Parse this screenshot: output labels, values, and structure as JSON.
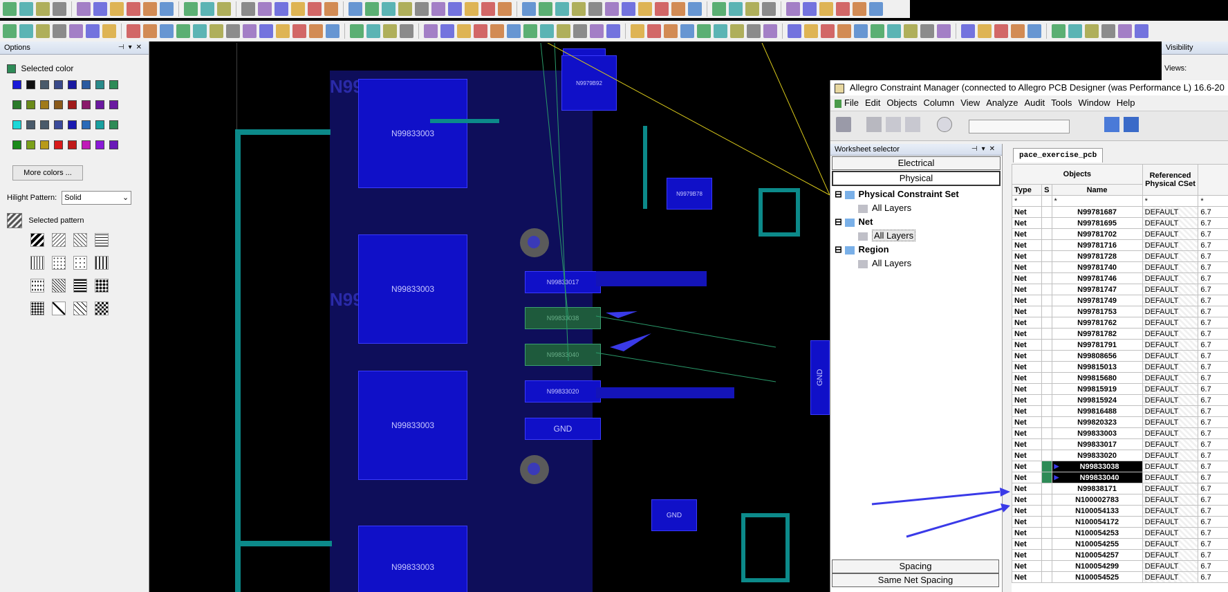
{
  "options": {
    "title": "Options",
    "selected_color_label": "Selected color",
    "more_colors_label": "More colors ...",
    "hilight_label": "Hilight Pattern:",
    "hilight_value": "Solid",
    "selected_pattern_label": "Selected pattern",
    "selected_color": "#2e8b57",
    "swatch_rows": [
      [
        "#1a1ad8",
        "#111111",
        "#4a5a6a",
        "#3a4a8a",
        "#1a1aa0",
        "#2a5aa0",
        "#2a8a8a",
        "#2e8b57"
      ],
      [
        "#2a7a2a",
        "#6a8a1a",
        "#a07a1a",
        "#8a5a1a",
        "#a01a1a",
        "#8a1a6a",
        "#6a1aa0",
        "#6a1aa0"
      ],
      [
        "#1ad8d8",
        "#4a5a6a",
        "#4a5a6a",
        "#3a4a9a",
        "#1a1ab0",
        "#2a6ab8",
        "#1aa0a0",
        "#2e8b57"
      ],
      [
        "#1a8a1a",
        "#7aa01a",
        "#b89a1a",
        "#d81a1a",
        "#c01a1a",
        "#c01ab8",
        "#8a1ad8",
        "#6a1ab8"
      ]
    ]
  },
  "canvas": {
    "pads_large": [
      "N99833003",
      "N99833003",
      "N99833003",
      "N99833003"
    ],
    "ghost_label_1": "N99833003",
    "ghost_label_2": "N99833003",
    "pad_n1": "N99833017",
    "pad_n2": "N99833038",
    "pad_n3": "N99833040",
    "pad_n4": "N99833020",
    "pad_gnd": "GND",
    "pad_gnd2": "GND",
    "pad_gnd3": "GND",
    "small_label_1": "N9979B92",
    "small_label_2": "N9979B78"
  },
  "visibility": {
    "title": "Visibility",
    "views_label": "Views:"
  },
  "cm": {
    "title": "Allegro Constraint Manager (connected to Allegro PCB Designer (was Performance L) 16.6-20",
    "menu": [
      "File",
      "Edit",
      "Objects",
      "Column",
      "View",
      "Analyze",
      "Audit",
      "Tools",
      "Window",
      "Help"
    ],
    "ws_title": "Worksheet selector",
    "btn_electrical": "Electrical",
    "btn_physical": "Physical",
    "tree": {
      "pcs": "Physical Constraint Set",
      "pcs_layers": "All Layers",
      "net": "Net",
      "net_layers": "All Layers",
      "region": "Region",
      "region_layers": "All Layers"
    },
    "btn_spacing": "Spacing",
    "btn_same_net": "Same Net Spacing",
    "tab": "pace_exercise_pcb",
    "grid": {
      "head_objects": "Objects",
      "head_ref": "Referenced Physical CSet",
      "col_type": "Type",
      "col_s": "S",
      "col_name": "Name",
      "filter_type": "*",
      "filter_name": "*",
      "filter_ref": "*",
      "filter_lw": "*",
      "rows": [
        {
          "type": "Net",
          "name": "N99781687",
          "ref": "DEFAULT",
          "lw": "6.7"
        },
        {
          "type": "Net",
          "name": "N99781695",
          "ref": "DEFAULT",
          "lw": "6.7"
        },
        {
          "type": "Net",
          "name": "N99781702",
          "ref": "DEFAULT",
          "lw": "6.7"
        },
        {
          "type": "Net",
          "name": "N99781716",
          "ref": "DEFAULT",
          "lw": "6.7"
        },
        {
          "type": "Net",
          "name": "N99781728",
          "ref": "DEFAULT",
          "lw": "6.7"
        },
        {
          "type": "Net",
          "name": "N99781740",
          "ref": "DEFAULT",
          "lw": "6.7"
        },
        {
          "type": "Net",
          "name": "N99781746",
          "ref": "DEFAULT",
          "lw": "6.7"
        },
        {
          "type": "Net",
          "name": "N99781747",
          "ref": "DEFAULT",
          "lw": "6.7"
        },
        {
          "type": "Net",
          "name": "N99781749",
          "ref": "DEFAULT",
          "lw": "6.7"
        },
        {
          "type": "Net",
          "name": "N99781753",
          "ref": "DEFAULT",
          "lw": "6.7"
        },
        {
          "type": "Net",
          "name": "N99781762",
          "ref": "DEFAULT",
          "lw": "6.7"
        },
        {
          "type": "Net",
          "name": "N99781782",
          "ref": "DEFAULT",
          "lw": "6.7"
        },
        {
          "type": "Net",
          "name": "N99781791",
          "ref": "DEFAULT",
          "lw": "6.7"
        },
        {
          "type": "Net",
          "name": "N99808656",
          "ref": "DEFAULT",
          "lw": "6.7"
        },
        {
          "type": "Net",
          "name": "N99815013",
          "ref": "DEFAULT",
          "lw": "6.7"
        },
        {
          "type": "Net",
          "name": "N99815680",
          "ref": "DEFAULT",
          "lw": "6.7"
        },
        {
          "type": "Net",
          "name": "N99815919",
          "ref": "DEFAULT",
          "lw": "6.7"
        },
        {
          "type": "Net",
          "name": "N99815924",
          "ref": "DEFAULT",
          "lw": "6.7"
        },
        {
          "type": "Net",
          "name": "N99816488",
          "ref": "DEFAULT",
          "lw": "6.7"
        },
        {
          "type": "Net",
          "name": "N99820323",
          "ref": "DEFAULT",
          "lw": "6.7"
        },
        {
          "type": "Net",
          "name": "N99833003",
          "ref": "DEFAULT",
          "lw": "6.7"
        },
        {
          "type": "Net",
          "name": "N99833017",
          "ref": "DEFAULT",
          "lw": "6.7"
        },
        {
          "type": "Net",
          "name": "N99833020",
          "ref": "DEFAULT",
          "lw": "6.7"
        },
        {
          "type": "Net",
          "name": "N99833038",
          "ref": "DEFAULT",
          "lw": "6.7",
          "selected": true
        },
        {
          "type": "Net",
          "name": "N99833040",
          "ref": "DEFAULT",
          "lw": "6.7",
          "selected": true
        },
        {
          "type": "Net",
          "name": "N99838171",
          "ref": "DEFAULT",
          "lw": "6.7"
        },
        {
          "type": "Net",
          "name": "N100002783",
          "ref": "DEFAULT",
          "lw": "6.7"
        },
        {
          "type": "Net",
          "name": "N100054133",
          "ref": "DEFAULT",
          "lw": "6.7"
        },
        {
          "type": "Net",
          "name": "N100054172",
          "ref": "DEFAULT",
          "lw": "6.7"
        },
        {
          "type": "Net",
          "name": "N100054253",
          "ref": "DEFAULT",
          "lw": "6.7"
        },
        {
          "type": "Net",
          "name": "N100054255",
          "ref": "DEFAULT",
          "lw": "6.7"
        },
        {
          "type": "Net",
          "name": "N100054257",
          "ref": "DEFAULT",
          "lw": "6.7"
        },
        {
          "type": "Net",
          "name": "N100054299",
          "ref": "DEFAULT",
          "lw": "6.7"
        },
        {
          "type": "Net",
          "name": "N100054525",
          "ref": "DEFAULT",
          "lw": "6.7"
        }
      ]
    }
  },
  "toolbar_colors": [
    "#3a78c8",
    "#d8a020",
    "#6a6a6a",
    "#2a9a4a",
    "#c83a3a",
    "#8a5ab8",
    "#2aa0a0",
    "#c86a20",
    "#4a4ad8",
    "#9a9a2a"
  ]
}
